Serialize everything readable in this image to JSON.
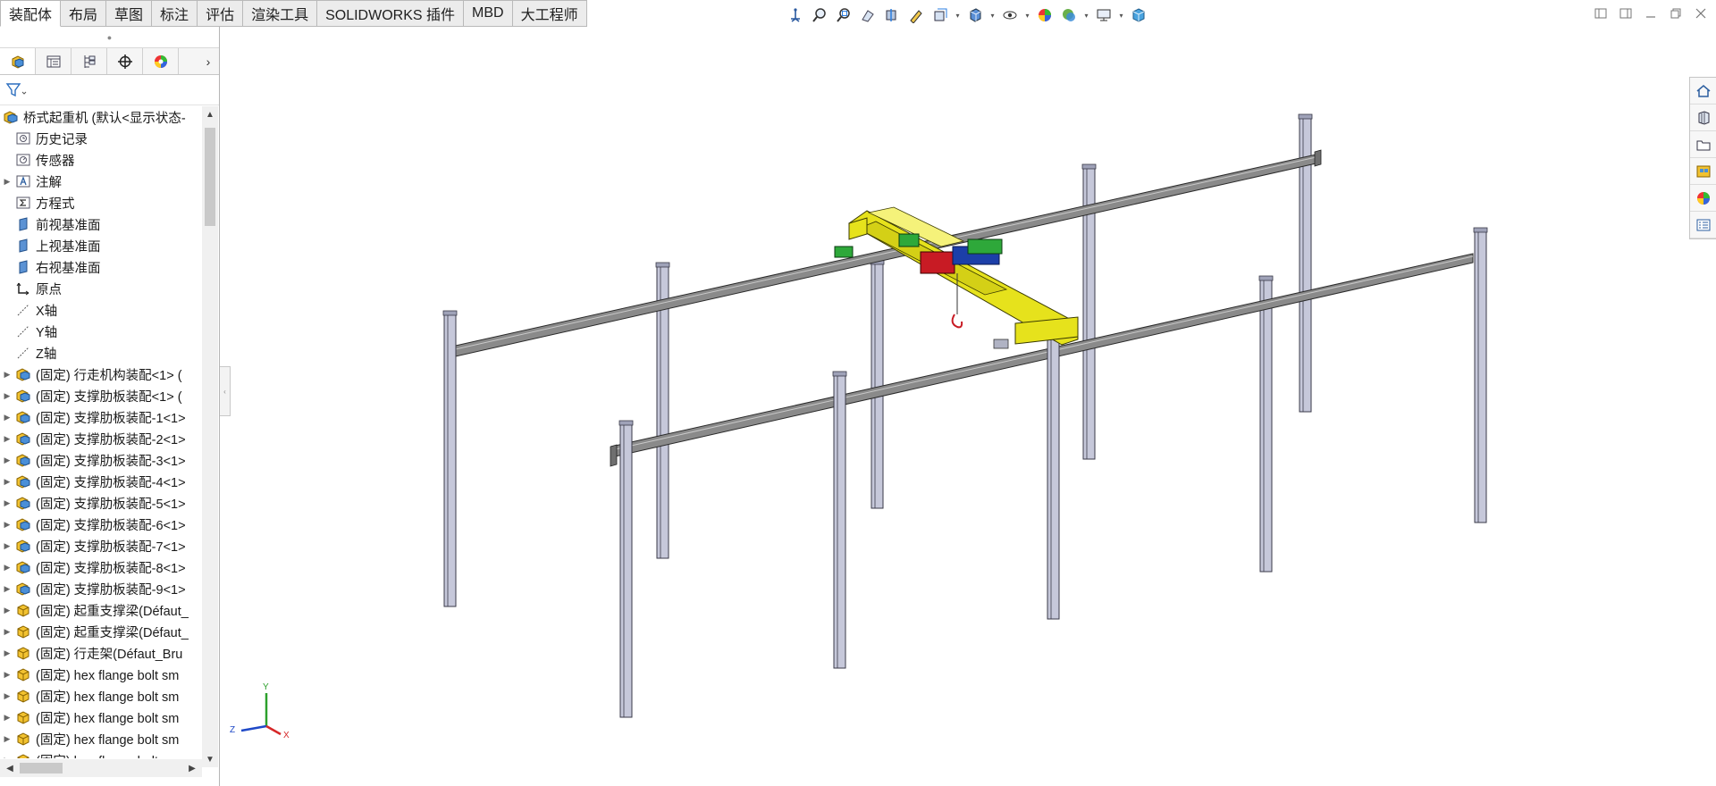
{
  "tabs": [
    {
      "label": "装配体"
    },
    {
      "label": "布局"
    },
    {
      "label": "草图"
    },
    {
      "label": "标注"
    },
    {
      "label": "评估"
    },
    {
      "label": "渲染工具"
    },
    {
      "label": "SOLIDWORKS 插件"
    },
    {
      "label": "MBD"
    },
    {
      "label": "大工程师"
    }
  ],
  "active_tab": "装配体",
  "tree": {
    "root": "桥式起重机  (默认<显示状态-",
    "items": [
      {
        "label": "历史记录",
        "icon": "history-icon"
      },
      {
        "label": "传感器",
        "icon": "sensor-icon"
      },
      {
        "label": "注解",
        "icon": "annotation-icon"
      },
      {
        "label": "方程式",
        "icon": "equation-icon"
      },
      {
        "label": "前视基准面",
        "icon": "plane-icon"
      },
      {
        "label": "上视基准面",
        "icon": "plane-icon"
      },
      {
        "label": "右视基准面",
        "icon": "plane-icon"
      },
      {
        "label": "原点",
        "icon": "origin-icon"
      },
      {
        "label": "X轴",
        "icon": "axis-icon"
      },
      {
        "label": "Y轴",
        "icon": "axis-icon"
      },
      {
        "label": "Z轴",
        "icon": "axis-icon"
      },
      {
        "label": "(固定) 行走机构装配<1> (",
        "icon": "assembly-icon"
      },
      {
        "label": "(固定) 支撑肋板装配<1> (",
        "icon": "assembly-icon"
      },
      {
        "label": "(固定) 支撑肋板装配-1<1>",
        "icon": "assembly-icon"
      },
      {
        "label": "(固定) 支撑肋板装配-2<1>",
        "icon": "assembly-icon"
      },
      {
        "label": "(固定) 支撑肋板装配-3<1>",
        "icon": "assembly-icon"
      },
      {
        "label": "(固定) 支撑肋板装配-4<1>",
        "icon": "assembly-icon"
      },
      {
        "label": "(固定) 支撑肋板装配-5<1>",
        "icon": "assembly-icon"
      },
      {
        "label": "(固定) 支撑肋板装配-6<1>",
        "icon": "assembly-icon"
      },
      {
        "label": "(固定) 支撑肋板装配-7<1>",
        "icon": "assembly-icon"
      },
      {
        "label": "(固定) 支撑肋板装配-8<1>",
        "icon": "assembly-icon"
      },
      {
        "label": "(固定) 支撑肋板装配-9<1>",
        "icon": "assembly-icon"
      },
      {
        "label": "(固定) 起重支撑梁(Défaut_",
        "icon": "part-icon"
      },
      {
        "label": "(固定) 起重支撑梁(Défaut_",
        "icon": "part-icon"
      },
      {
        "label": "(固定) 行走架(Défaut_Bru",
        "icon": "part-icon"
      },
      {
        "label": "(固定) hex flange bolt sm",
        "icon": "part-icon"
      },
      {
        "label": "(固定) hex flange bolt sm",
        "icon": "part-icon"
      },
      {
        "label": "(固定) hex flange bolt sm",
        "icon": "part-icon"
      },
      {
        "label": "(固定) hex flange bolt sm",
        "icon": "part-icon"
      },
      {
        "label": "(固定) hex flange bolt sm",
        "icon": "part-icon"
      }
    ]
  },
  "triad": {
    "x": "X",
    "y": "Y",
    "z": "Z"
  },
  "colors": {
    "column": "#c6c8da",
    "rail": "#8a8a8a",
    "girder": "#e6e21c",
    "hoist_green": "#2ea83a",
    "hoist_red": "#c81b24"
  }
}
